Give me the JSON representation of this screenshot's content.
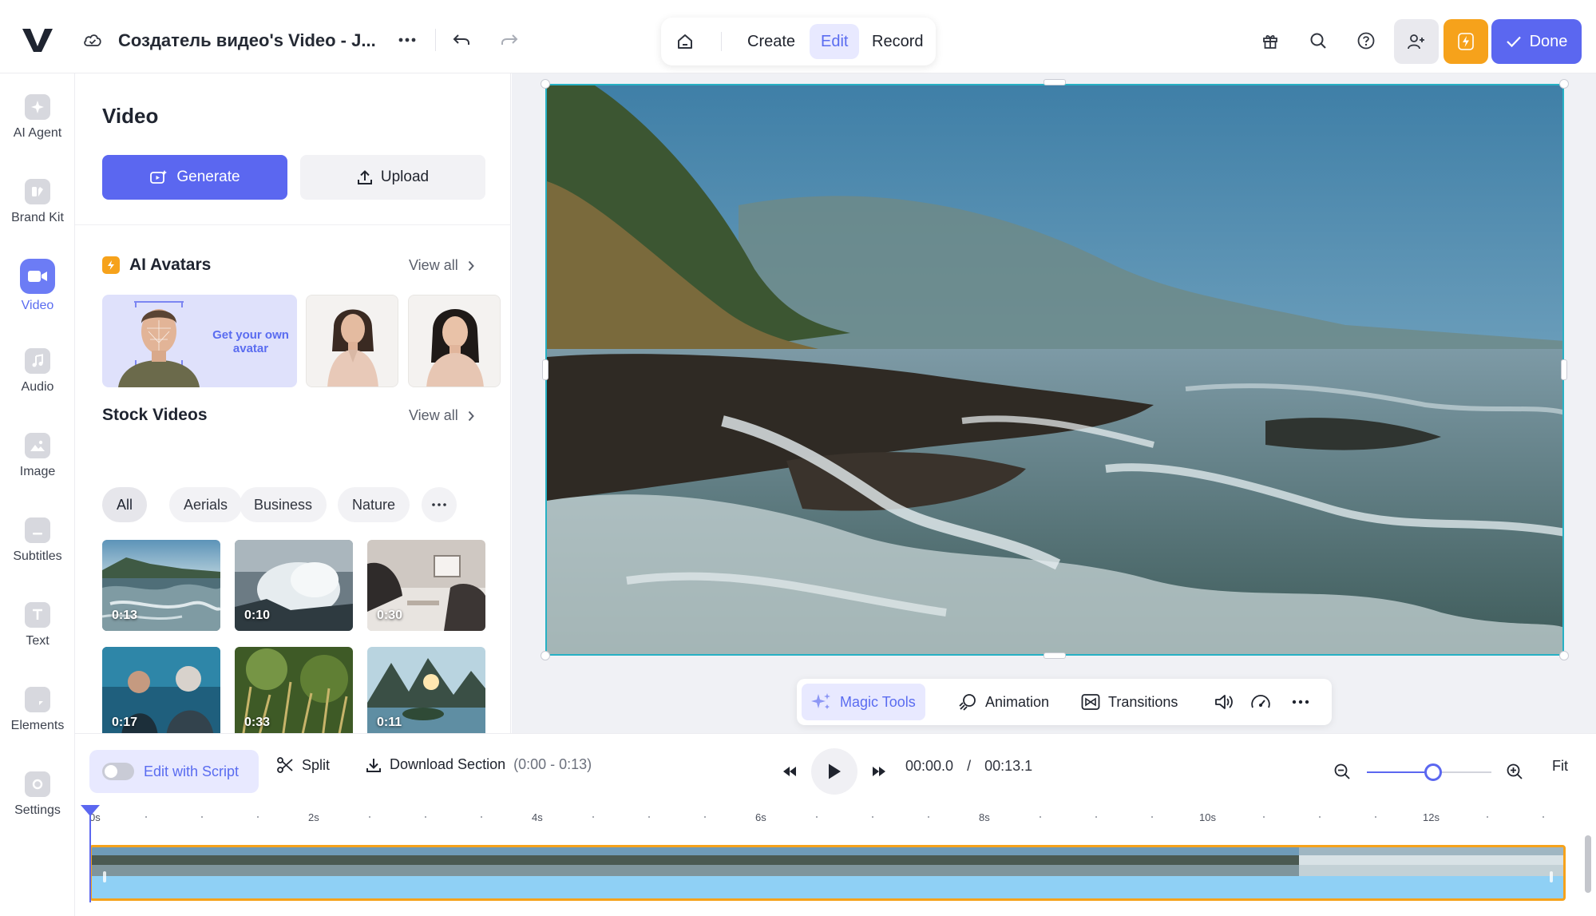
{
  "topbar": {
    "doc_title": "Создатель видео's Video - J...",
    "modes": {
      "create": "Create",
      "edit": "Edit",
      "record": "Record",
      "active": "Edit"
    },
    "done_label": "Done"
  },
  "rail": {
    "items": [
      {
        "label": "AI Agent",
        "icon": "sparkle-icon"
      },
      {
        "label": "Brand Kit",
        "icon": "brand-kit-icon"
      },
      {
        "label": "Video",
        "icon": "video-camera-icon",
        "active": true
      },
      {
        "label": "Audio",
        "icon": "music-note-icon"
      },
      {
        "label": "Image",
        "icon": "image-icon"
      },
      {
        "label": "Subtitles",
        "icon": "subtitles-icon"
      },
      {
        "label": "Text",
        "icon": "text-icon"
      },
      {
        "label": "Elements",
        "icon": "elements-icon"
      },
      {
        "label": "Settings",
        "icon": "settings-icon"
      }
    ]
  },
  "panel": {
    "title": "Video",
    "generate_label": "Generate",
    "upload_label": "Upload",
    "avatars": {
      "title": "AI Avatars",
      "view_all": "View all",
      "get_avatar": "Get your own avatar"
    },
    "stock": {
      "title": "Stock Videos",
      "view_all": "View all",
      "chips": [
        "All",
        "Aerials",
        "Business",
        "Nature"
      ],
      "active_chip": "All",
      "thumbs": [
        {
          "duration": "0:13"
        },
        {
          "duration": "0:10"
        },
        {
          "duration": "0:30"
        },
        {
          "duration": "0:17"
        },
        {
          "duration": "0:33"
        },
        {
          "duration": "0:11"
        }
      ]
    }
  },
  "tools": {
    "magic_tools": "Magic Tools",
    "animation": "Animation",
    "transitions": "Transitions"
  },
  "timeline": {
    "edit_with_script": "Edit with Script",
    "edit_with_script_on": false,
    "split": "Split",
    "download_section": "Download Section",
    "download_range": "(0:00 - 0:13)",
    "current_time": "00:00.0",
    "separator": "/",
    "total_time": "00:13.1",
    "fit": "Fit",
    "zoom_level_fraction": 0.49,
    "ruler": {
      "labels": [
        "0s",
        "2s",
        "4s",
        "6s",
        "8s",
        "10s",
        "12s"
      ],
      "duration_seconds": 13.1
    }
  },
  "colors": {
    "accent": "#5b67f0",
    "accent_light": "#e8e9ff",
    "orange": "#f6a21b",
    "selection": "#27b1c4"
  }
}
